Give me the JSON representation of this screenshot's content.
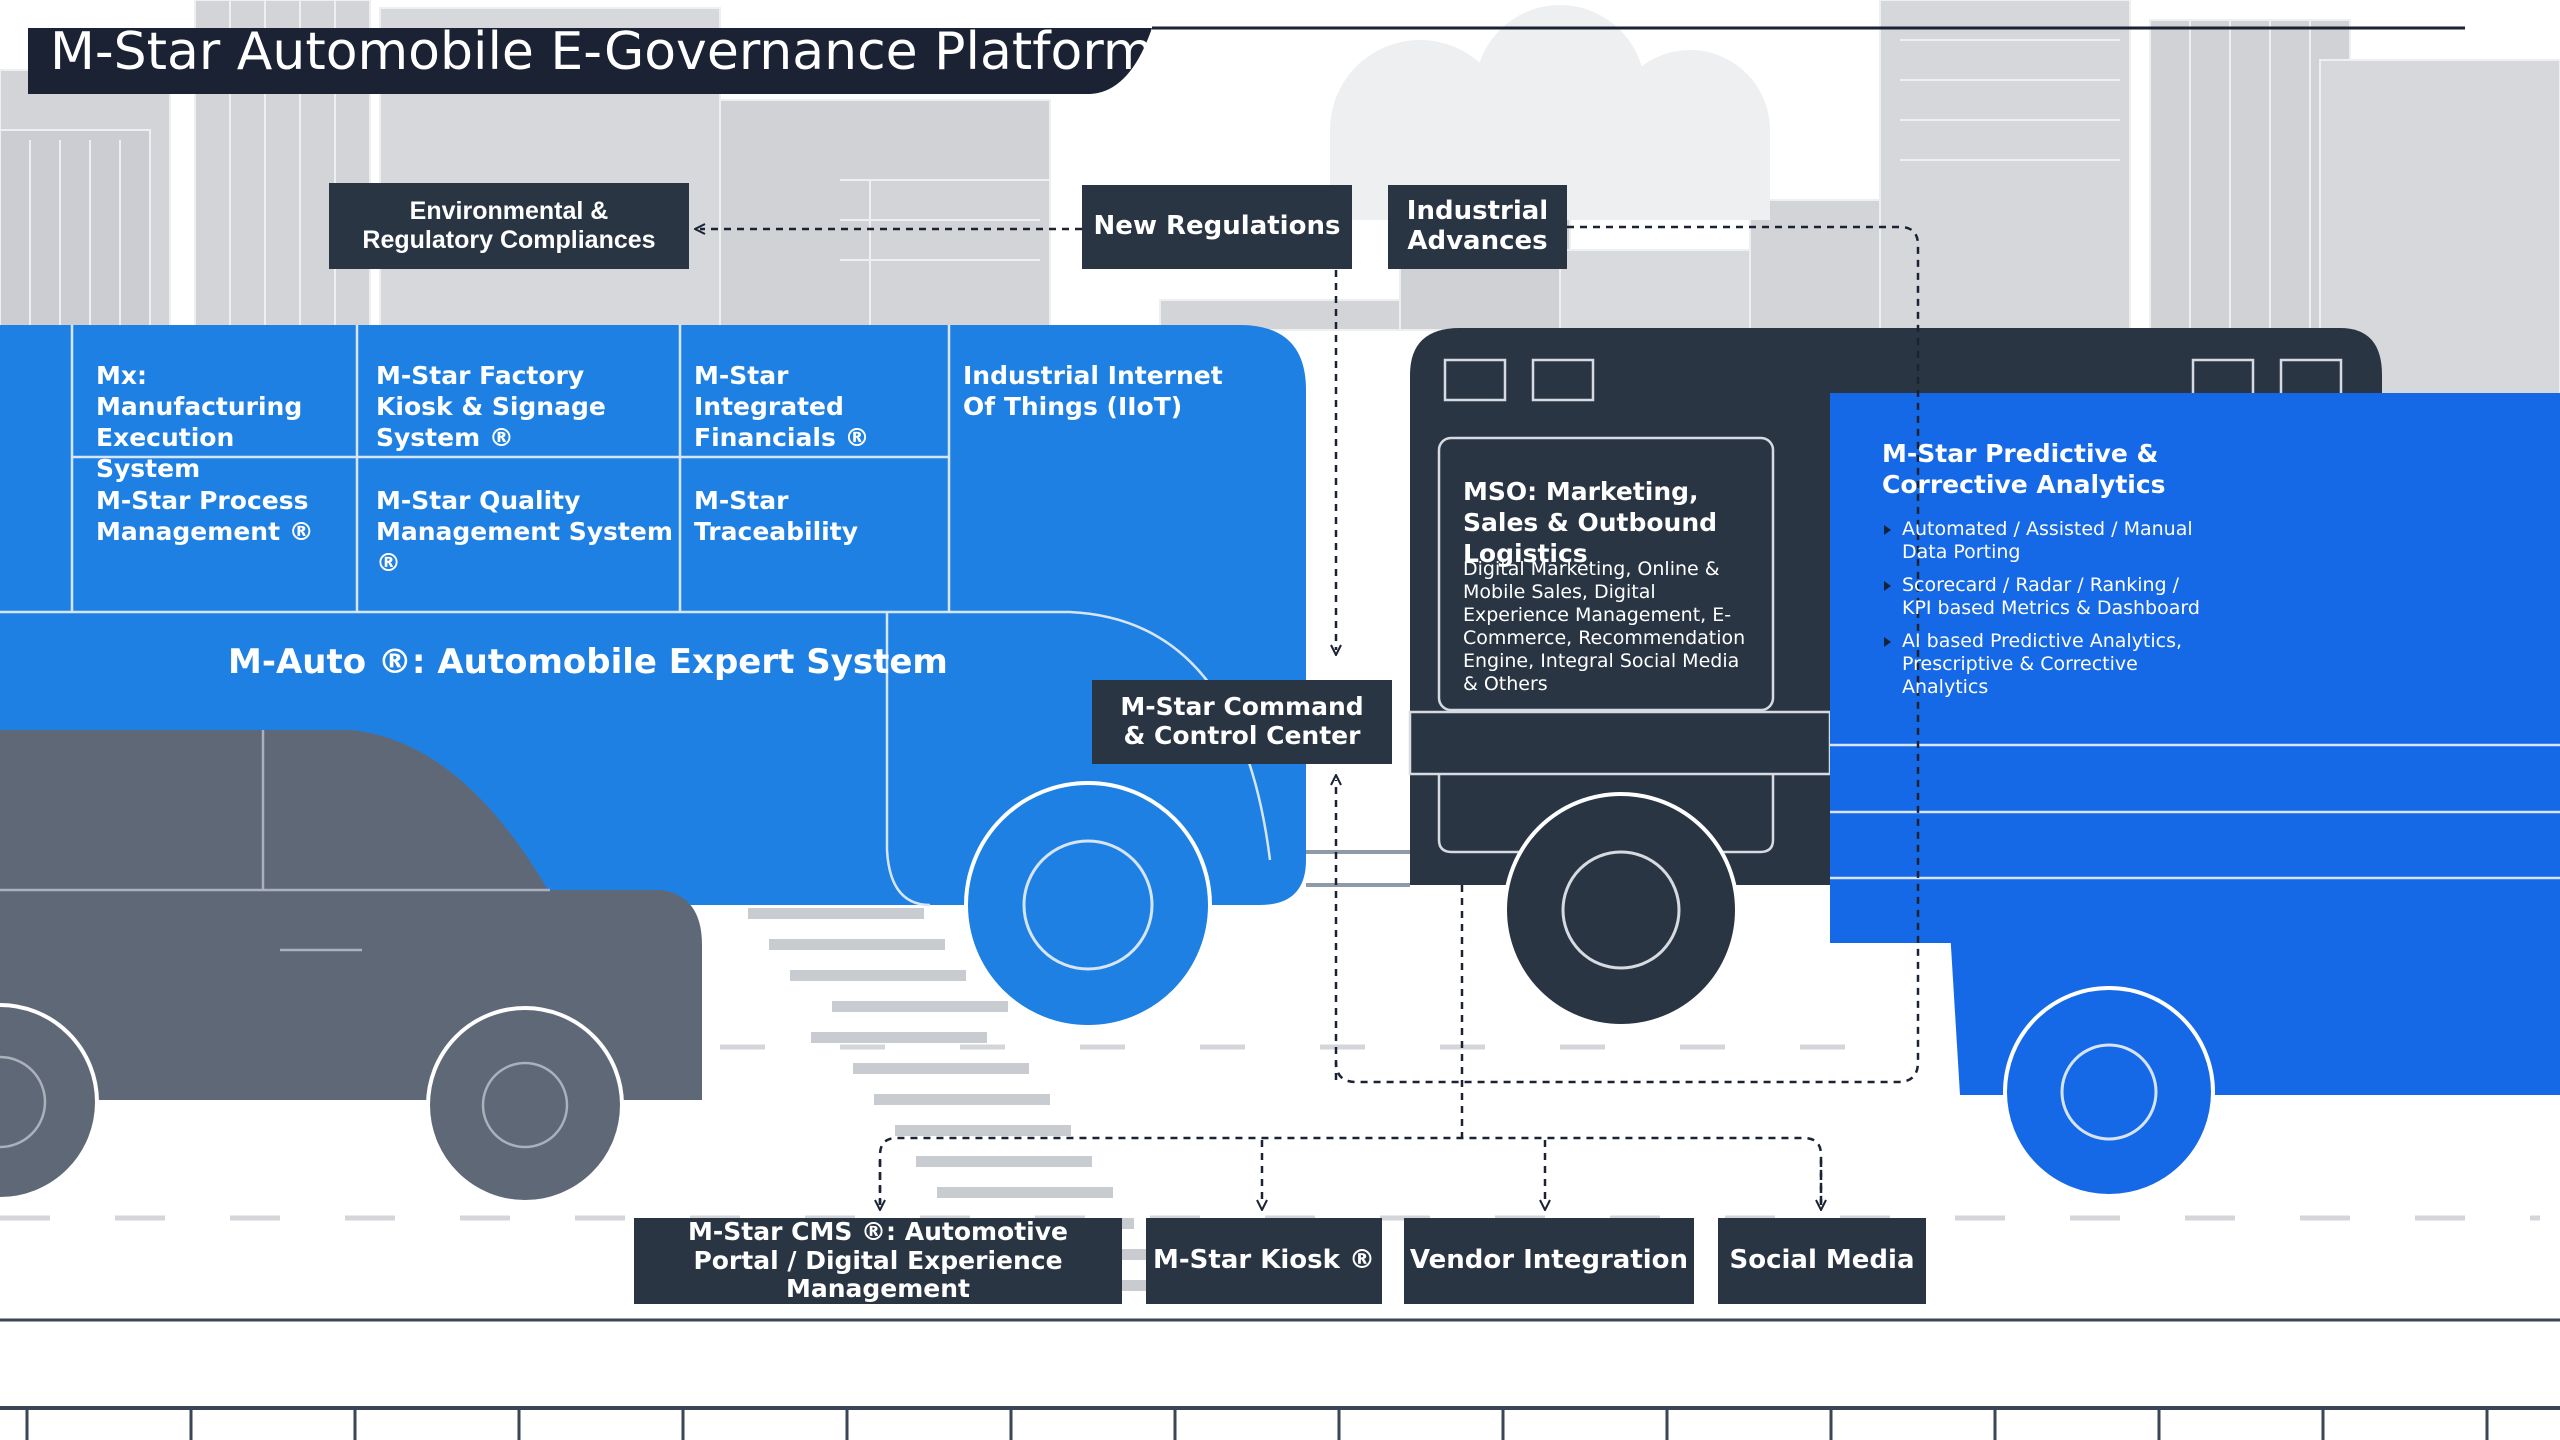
{
  "title": "M-Star Automobile E-Governance Platform",
  "colors": {
    "dark": "#2a3544",
    "blue": "#1f80e3",
    "blue_bright": "#1568e6",
    "grey_car": "#5e6877",
    "city": "#d2d4d8"
  },
  "bus": {
    "cells": {
      "mes": "Mx: Manufacturing Execution System",
      "kiosk_signage": "M-Star Factory Kiosk & Signage System ®",
      "financials": "M-Star Integrated Financials ®",
      "iiot": "Industrial Internet Of Things (IIoT)",
      "process": "M-Star Process Management ®",
      "quality": "M-Star Quality Management System ®",
      "traceability": "M-Star Traceability"
    },
    "label": "M-Auto ®: Automobile Expert System"
  },
  "top_boxes": {
    "environmental": "Environmental & Regulatory Compliances",
    "new_regulations": "New Regulations",
    "industrial_advances": "Industrial Advances"
  },
  "command_center": "M-Star Command & Control Center",
  "truck": {
    "heading": "MSO: Marketing, Sales & Outbound Logistics",
    "body": "Digital Marketing, Online & Mobile Sales, Digital Experience Management, E-Commerce, Recommendation Engine, Integral Social Media & Others"
  },
  "analytics": {
    "heading": "M-Star Predictive & Corrective Analytics",
    "bullets": [
      "Automated / Assisted / Manual Data Porting",
      "Scorecard / Radar / Ranking / KPI based Metrics & Dashboard",
      "AI based Predictive Analytics, Prescriptive & Corrective Analytics"
    ]
  },
  "bottom_boxes": {
    "cms": "M-Star CMS ®: Automotive Portal / Digital Experience Management",
    "kiosk": "M-Star Kiosk ®",
    "vendor": "Vendor Integration",
    "social": "Social Media"
  }
}
